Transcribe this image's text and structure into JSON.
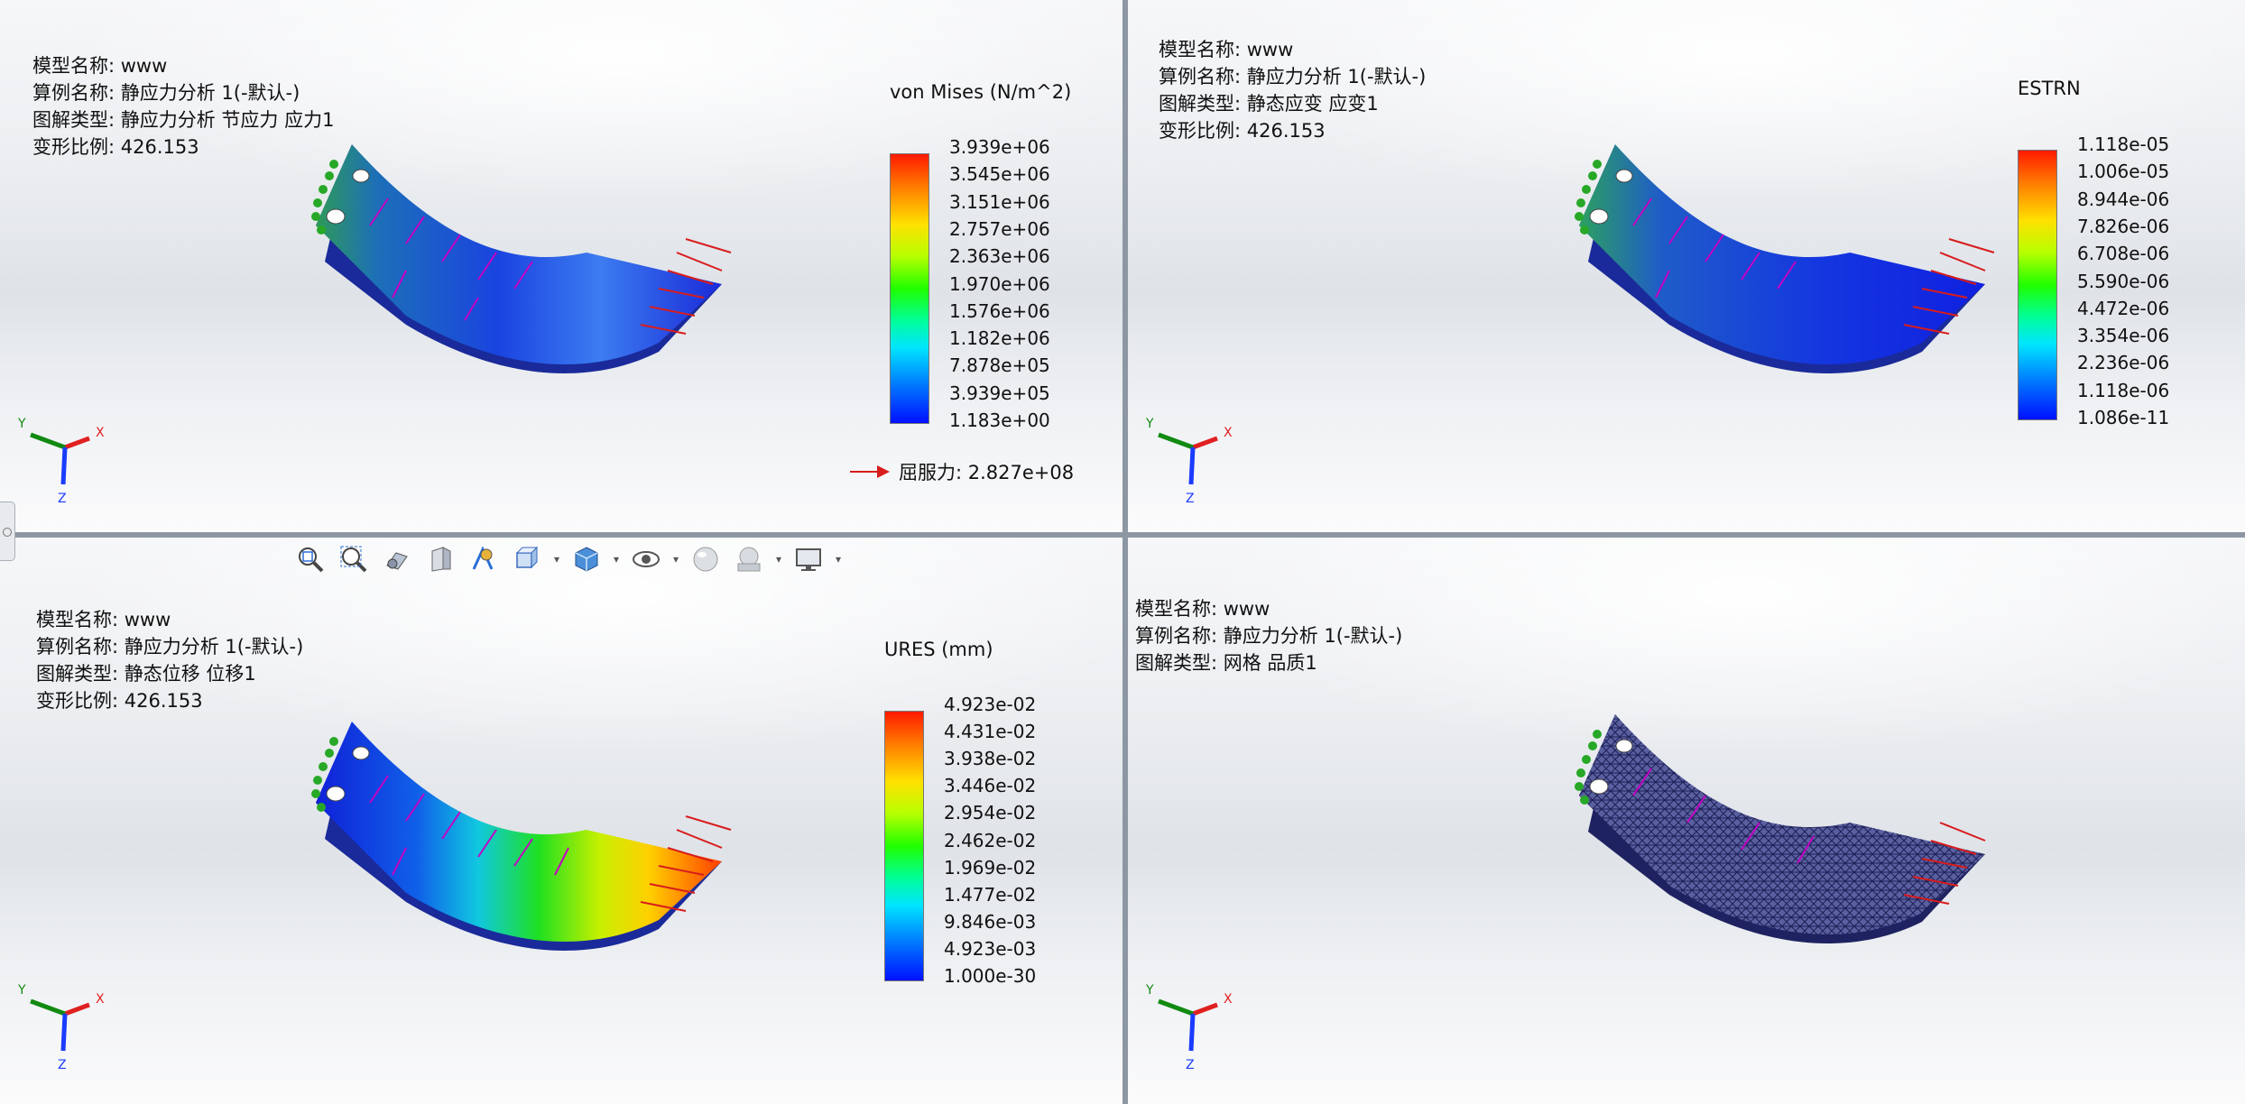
{
  "common": {
    "scale_note": ""
  },
  "viewports": {
    "top_left": {
      "info": {
        "model": "模型名称: www",
        "study": "算例名称: 静应力分析 1(-默认-)",
        "plot_type": "图解类型: 静应力分析 节应力 应力1",
        "deform_scale": "变形比例: 426.153"
      },
      "legend": {
        "title": "von Mises (N/m^2)",
        "ticks": [
          "3.939e+06",
          "3.545e+06",
          "3.151e+06",
          "2.757e+06",
          "2.363e+06",
          "1.970e+06",
          "1.576e+06",
          "1.182e+06",
          "7.878e+05",
          "3.939e+05",
          "1.183e+00"
        ]
      },
      "yield": "屈服力: 2.827e+08",
      "triad": {
        "x": "X",
        "y": "Y",
        "z": "Z"
      }
    },
    "top_right": {
      "info": {
        "model": "模型名称: www",
        "study": "算例名称: 静应力分析 1(-默认-)",
        "plot_type": "图解类型: 静态应变 应变1",
        "deform_scale": "变形比例: 426.153"
      },
      "legend": {
        "title": "ESTRN",
        "ticks": [
          "1.118e-05",
          "1.006e-05",
          "8.944e-06",
          "7.826e-06",
          "6.708e-06",
          "5.590e-06",
          "4.472e-06",
          "3.354e-06",
          "2.236e-06",
          "1.118e-06",
          "1.086e-11"
        ]
      },
      "triad": {
        "x": "X",
        "y": "Y",
        "z": "Z"
      }
    },
    "bottom_left": {
      "info": {
        "model": "模型名称: www",
        "study": "算例名称: 静应力分析 1(-默认-)",
        "plot_type": "图解类型: 静态位移 位移1",
        "deform_scale": "变形比例: 426.153"
      },
      "legend": {
        "title": "URES (mm)",
        "ticks": [
          "4.923e-02",
          "4.431e-02",
          "3.938e-02",
          "3.446e-02",
          "2.954e-02",
          "2.462e-02",
          "1.969e-02",
          "1.477e-02",
          "9.846e-03",
          "4.923e-03",
          "1.000e-30"
        ]
      },
      "triad": {
        "x": "X",
        "y": "Y",
        "z": "Z"
      }
    },
    "bottom_right": {
      "info": {
        "model": "模型名称: www",
        "study": "算例名称: 静应力分析 1(-默认-)",
        "plot_type": "图解类型: 网格 品质1"
      },
      "triad": {
        "x": "X",
        "y": "Y",
        "z": "Z"
      }
    }
  },
  "toolbar": {
    "buttons": [
      {
        "icon": "zoom-to-fit-icon"
      },
      {
        "icon": "zoom-to-area-icon"
      },
      {
        "icon": "previous-view-icon"
      },
      {
        "icon": "section-view-icon"
      },
      {
        "icon": "view-orientation-icon"
      },
      {
        "icon": "view-orientation-box-icon",
        "dropdown": true
      },
      {
        "icon": "display-style-icon",
        "dropdown": true
      },
      {
        "icon": "hide-show-items-icon",
        "dropdown": true
      },
      {
        "icon": "edit-appearance-icon"
      },
      {
        "icon": "apply-scene-icon",
        "dropdown": true
      },
      {
        "icon": "view-settings-icon",
        "dropdown": true
      }
    ]
  },
  "colors": {
    "legend_top": "#ff1a00",
    "legend_bottom": "#0010ff",
    "fixture": "#27a827",
    "load_arrow": "#d81c1c",
    "pressure_arrow": "#c400c4",
    "triad_x": "#e02020",
    "triad_y": "#118a11",
    "triad_z": "#1a3cff"
  }
}
